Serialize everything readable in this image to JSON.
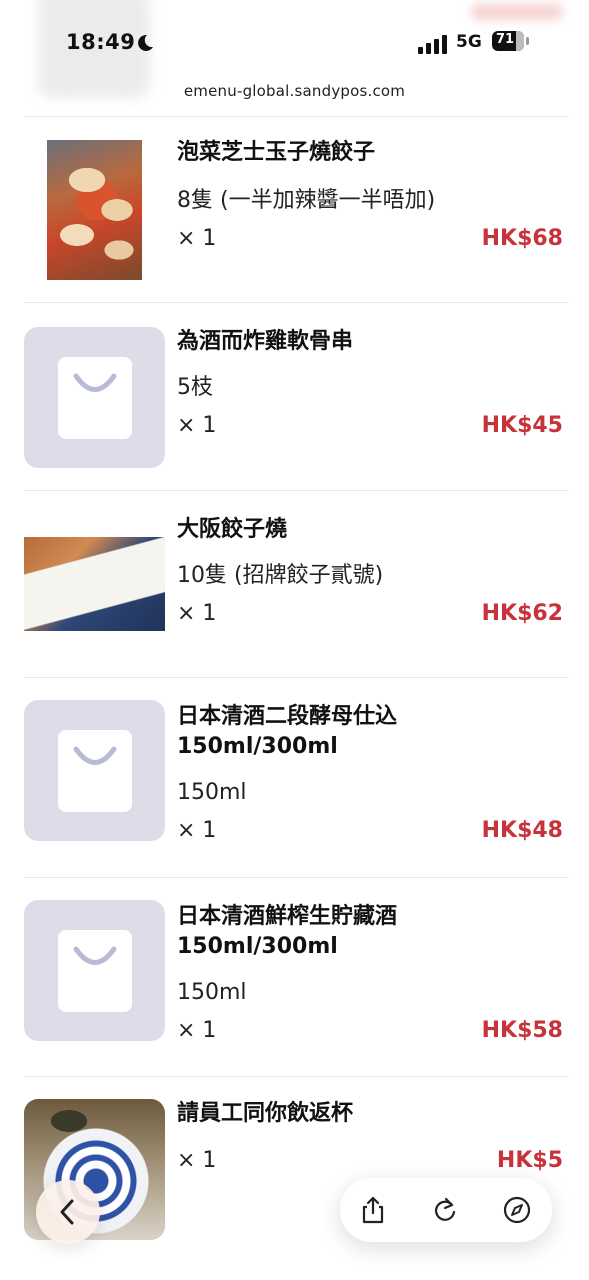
{
  "status_bar": {
    "time": "18:49",
    "network": "5G",
    "battery": "71"
  },
  "url_bar": {
    "domain": "emenu-global.sandypos.com"
  },
  "items": [
    {
      "name": "泡菜芝士玉子燒餃子",
      "desc": "8隻 (一半加辣醬一半唔加)",
      "qty": "× 1",
      "price": "HK$68",
      "image": "photo"
    },
    {
      "name": "為酒而炸雞軟骨串",
      "desc": "5枝",
      "qty": "× 1",
      "price": "HK$45",
      "image": "placeholder"
    },
    {
      "name": "大阪餃子燒",
      "desc": "10隻 (招牌餃子貳號)",
      "qty": "× 1",
      "price": "HK$62",
      "image": "photo"
    },
    {
      "name": "日本清酒二段酵母仕込 150ml/300ml",
      "desc": "150ml",
      "qty": "× 1",
      "price": "HK$48",
      "image": "placeholder"
    },
    {
      "name": "日本清酒鮮榨生貯藏酒 150ml/300ml",
      "desc": "150ml",
      "qty": "× 1",
      "price": "HK$58",
      "image": "placeholder"
    },
    {
      "name": "請員工同你飲返杯",
      "qty": "× 1",
      "price": "HK$5",
      "image": "photo"
    }
  ],
  "colors": {
    "price": "#c8323a",
    "placeholder_bg": "#dcdde9",
    "placeholder_icon": "#b8bbd6"
  },
  "icons": [
    "moon-icon",
    "signal-icon",
    "battery-icon",
    "shopping-bag-icon",
    "chevron-left-icon",
    "share-icon",
    "reload-icon",
    "compass-icon"
  ]
}
